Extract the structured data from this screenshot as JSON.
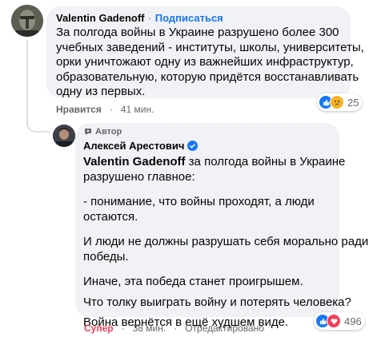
{
  "comment1": {
    "author": "Valentin Gadenoff",
    "separator": "·",
    "follow_label": "Подписаться",
    "lines": [
      "За полгода войны в Украине разрушено более 300",
      "учебных заведений - институты, школы, университеты,",
      "орки уничтожают одну из важнейших инфраструктур,",
      "образовательную, которую придётся восстанавливать",
      "одну из первых."
    ],
    "reaction_count": "25",
    "action_label": "Нравится",
    "time": "41 мин."
  },
  "comment2": {
    "badge_label": "Автор",
    "author": "Алексей Арестович",
    "mention": "Valentin Gadenoff",
    "first_line_rest": " за полгода войны в Украине",
    "line2": "разрушено главное:",
    "para2_line1": "- понимание, что войны проходят, а люди",
    "para2_line2": "остаются.",
    "para3_line1": "И люди не должны разрушать себя морально ради",
    "para3_line2": "победы.",
    "para4": "Иначе, эта победа станет проигрышем.",
    "para5": "Что толку выиграть войну и потерять человека?",
    "para6": "Война вернётся в ещё худшем виде.",
    "reaction_count": "496",
    "action_label": "Супер",
    "time": "38 мин.",
    "edited_label": "Отредактировано"
  },
  "colors": {
    "link": "#1877f2",
    "super": "#f33e58",
    "bubble": "#f0f2f5",
    "secondary_text": "#65676b"
  },
  "icons": [
    "like-icon",
    "sad-icon",
    "love-icon",
    "verified-icon",
    "author-badge-icon"
  ]
}
